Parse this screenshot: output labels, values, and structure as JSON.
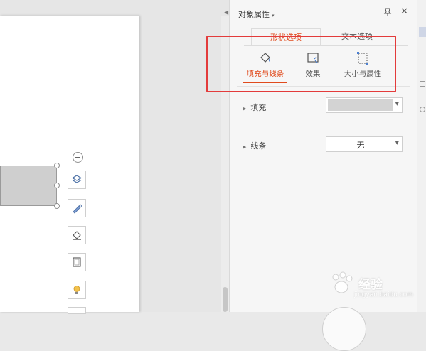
{
  "panel": {
    "title": "对象属性",
    "tabs": [
      {
        "label": "形状选项",
        "active": true
      },
      {
        "label": "文本选项",
        "active": false
      }
    ],
    "subtabs": [
      {
        "label": "填充与线条",
        "icon": "fill-bucket-icon",
        "active": true
      },
      {
        "label": "效果",
        "icon": "effect-icon",
        "active": false
      },
      {
        "label": "大小与属性",
        "icon": "size-property-icon",
        "active": false
      }
    ],
    "properties": {
      "fill": {
        "label": "填充",
        "value_color": "#d3d3d3"
      },
      "line": {
        "label": "线条",
        "value": "无"
      }
    }
  },
  "watermark": {
    "text": "经验",
    "sub": "jingyan.baidu.com"
  },
  "colors": {
    "accent": "#e04a1c",
    "highlight_box": "#e33b3b",
    "shape_fill": "#cfcfcf"
  }
}
